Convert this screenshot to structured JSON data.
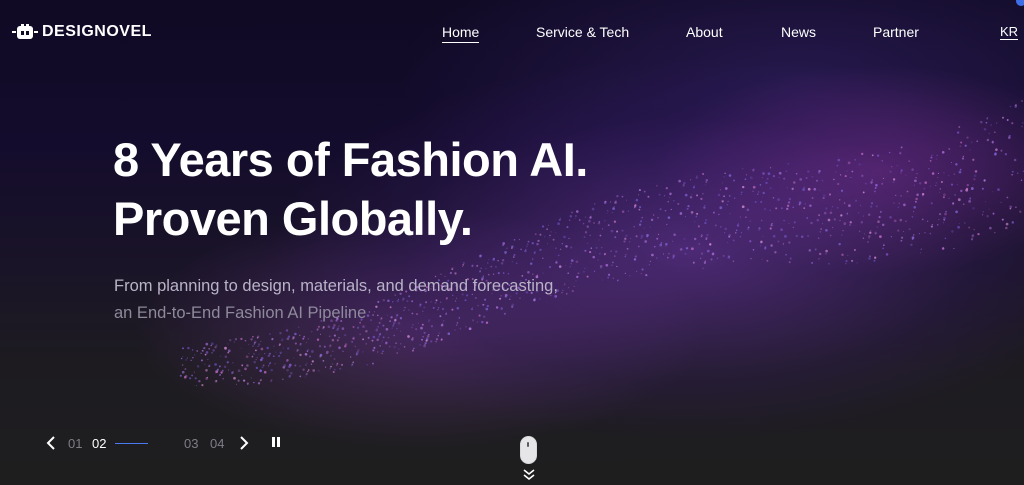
{
  "brand": {
    "name": "DESIGNOVEL"
  },
  "nav": {
    "items": [
      {
        "label": "Home",
        "active": true
      },
      {
        "label": "Service & Tech",
        "active": false
      },
      {
        "label": "About",
        "active": false
      },
      {
        "label": "News",
        "active": false
      },
      {
        "label": "Partner",
        "active": false
      }
    ],
    "language": "KR"
  },
  "hero": {
    "headline_line1": "8 Years of Fashion AI.",
    "headline_line2": "Proven Globally.",
    "subline_line1": "From planning to design, materials, and demand forecasting,",
    "subline_line2": "an End-to-End Fashion AI Pipeline"
  },
  "slider": {
    "slides": [
      "01",
      "02",
      "03",
      "04"
    ],
    "current": "02"
  },
  "colors": {
    "accent": "#4a79f0",
    "text": "#ffffff",
    "muted": "#7f7d86",
    "subtext": "#b9b3c9"
  },
  "icons": {
    "prev": "chevron-left-icon",
    "next": "chevron-right-icon",
    "pause": "pause-icon",
    "scroll": "mouse-scroll-icon",
    "scroll_arrows": "double-chevron-down-icon"
  }
}
